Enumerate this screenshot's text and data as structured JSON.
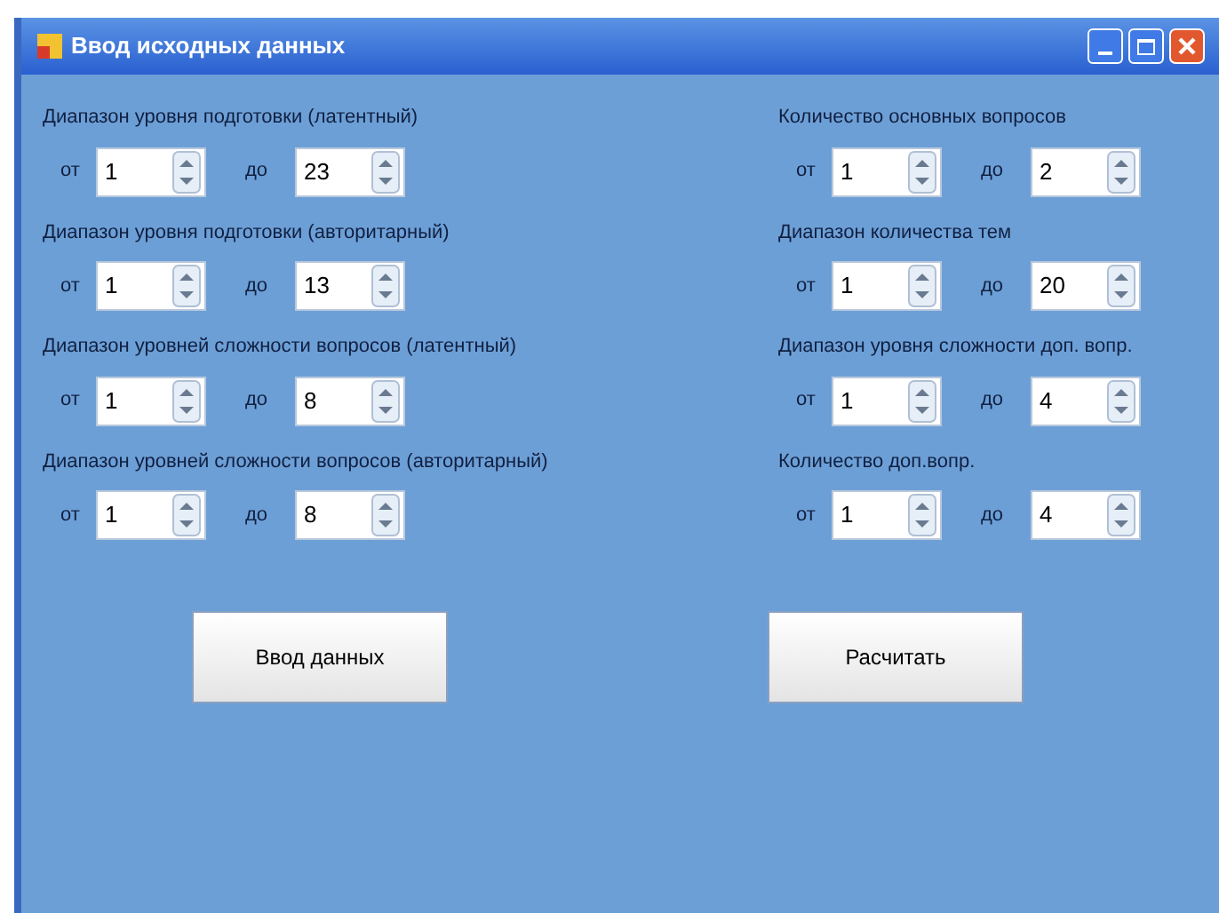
{
  "window": {
    "title": "Ввод исходных данных"
  },
  "left_groups": [
    {
      "label": "Диапазон уровня подготовки (латентный)",
      "from_label": "от",
      "from": "1",
      "to_label": "до",
      "to": "23"
    },
    {
      "label": "Диапазон уровня подготовки (авторитарный)",
      "from_label": "от",
      "from": "1",
      "to_label": "до",
      "to": "13"
    },
    {
      "label": "Диапазон уровней сложности вопросов (латентный)",
      "from_label": "от",
      "from": "1",
      "to_label": "до",
      "to": "8"
    },
    {
      "label": "Диапазон уровней сложности вопросов (авторитарный)",
      "from_label": "от",
      "from": "1",
      "to_label": "до",
      "to": "8"
    }
  ],
  "right_groups": [
    {
      "label": "Количество основных вопросов",
      "from_label": "от",
      "from": "1",
      "to_label": "до",
      "to": "2"
    },
    {
      "label": "Диапазон количества тем",
      "from_label": "от",
      "from": "1",
      "to_label": "до",
      "to": "20"
    },
    {
      "label": "Диапазон уровня сложности доп. вопр.",
      "from_label": "от",
      "from": "1",
      "to_label": "до",
      "to": "4"
    },
    {
      "label": "Количество доп.вопр.",
      "from_label": "от",
      "from": "1",
      "to_label": "до",
      "to": "4"
    }
  ],
  "buttons": [
    "Ввод данных",
    "Расчитать"
  ]
}
